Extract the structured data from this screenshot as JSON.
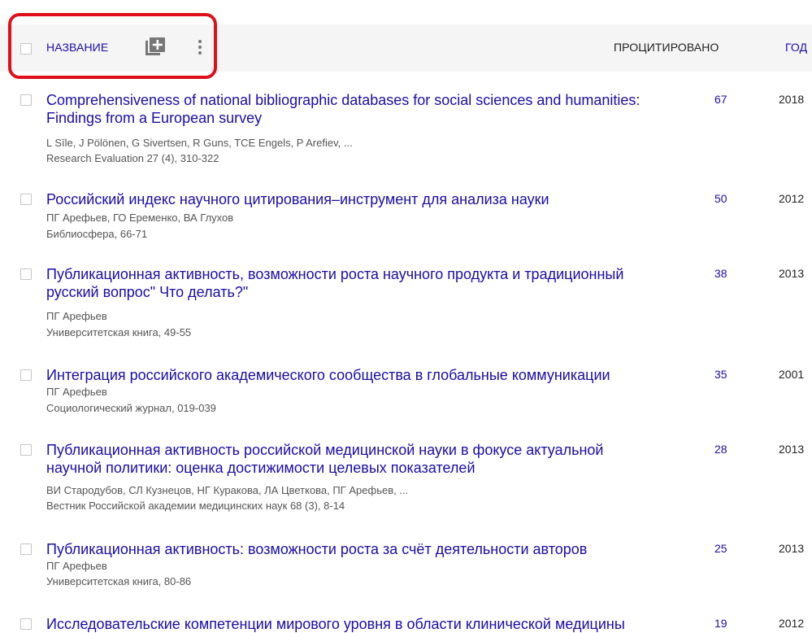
{
  "header": {
    "title_label": "НАЗВАНИЕ",
    "cited_label": "ПРОЦИТИРОВАНО",
    "year_label": "ГОД",
    "add_icon": "add-box-icon",
    "more_icon": "more-vert-icon"
  },
  "colors": {
    "link": "#1a0dab",
    "highlight": "#e0101a",
    "header_bg": "#f5f5f5",
    "meta_text": "#555555"
  },
  "rows": [
    {
      "title": "Comprehensiveness of national bibliographic databases for social sciences and humanities: Findings from a European survey",
      "authors": "L Sīle, J Pölönen, G Sivertsen, R Guns, TCE Engels, P Arefiev, ...",
      "venue": "Research Evaluation 27 (4), 310-322",
      "cited": "67",
      "year": "2018"
    },
    {
      "title": "Российский индекс научного цитирования–инструмент для анализа науки",
      "authors": "ПГ Арефьев, ГО Еременко, ВА Глухов",
      "venue": "Библиосфера, 66-71",
      "cited": "50",
      "year": "2012"
    },
    {
      "title": "Публикационная активность, возможности роста научного продукта и традиционный русский вопрос\" Что делать?\"",
      "authors": "ПГ Арефьев",
      "venue": "Университетская книга, 49-55",
      "cited": "38",
      "year": "2013"
    },
    {
      "title": "Интеграция российского академического сообщества в глобальные коммуникации",
      "authors": "ПГ Арефьев",
      "venue": "Социологический журнал, 019-039",
      "cited": "35",
      "year": "2001"
    },
    {
      "title": "Публикационная активность российской медицинской науки в фокусе актуальной научной политики: оценка достижимости целевых показателей",
      "authors": "ВИ Стародубов, СЛ Кузнецов, НГ Куракова, ЛА Цветкова, ПГ Арефьев, ...",
      "venue": "Вестник Российской академии медицинских наук 68 (3), 8-14",
      "cited": "28",
      "year": "2013"
    },
    {
      "title": "Публикационная активность: возможности роста за счёт деятельности авторов",
      "authors": "ПГ Арефьев",
      "venue": "Университетская книга, 80-86",
      "cited": "25",
      "year": "2013"
    },
    {
      "title": "Исследовательские компетенции мирового уровня в области клинической медицины",
      "authors": "",
      "venue": "",
      "cited": "19",
      "year": "2012"
    }
  ]
}
